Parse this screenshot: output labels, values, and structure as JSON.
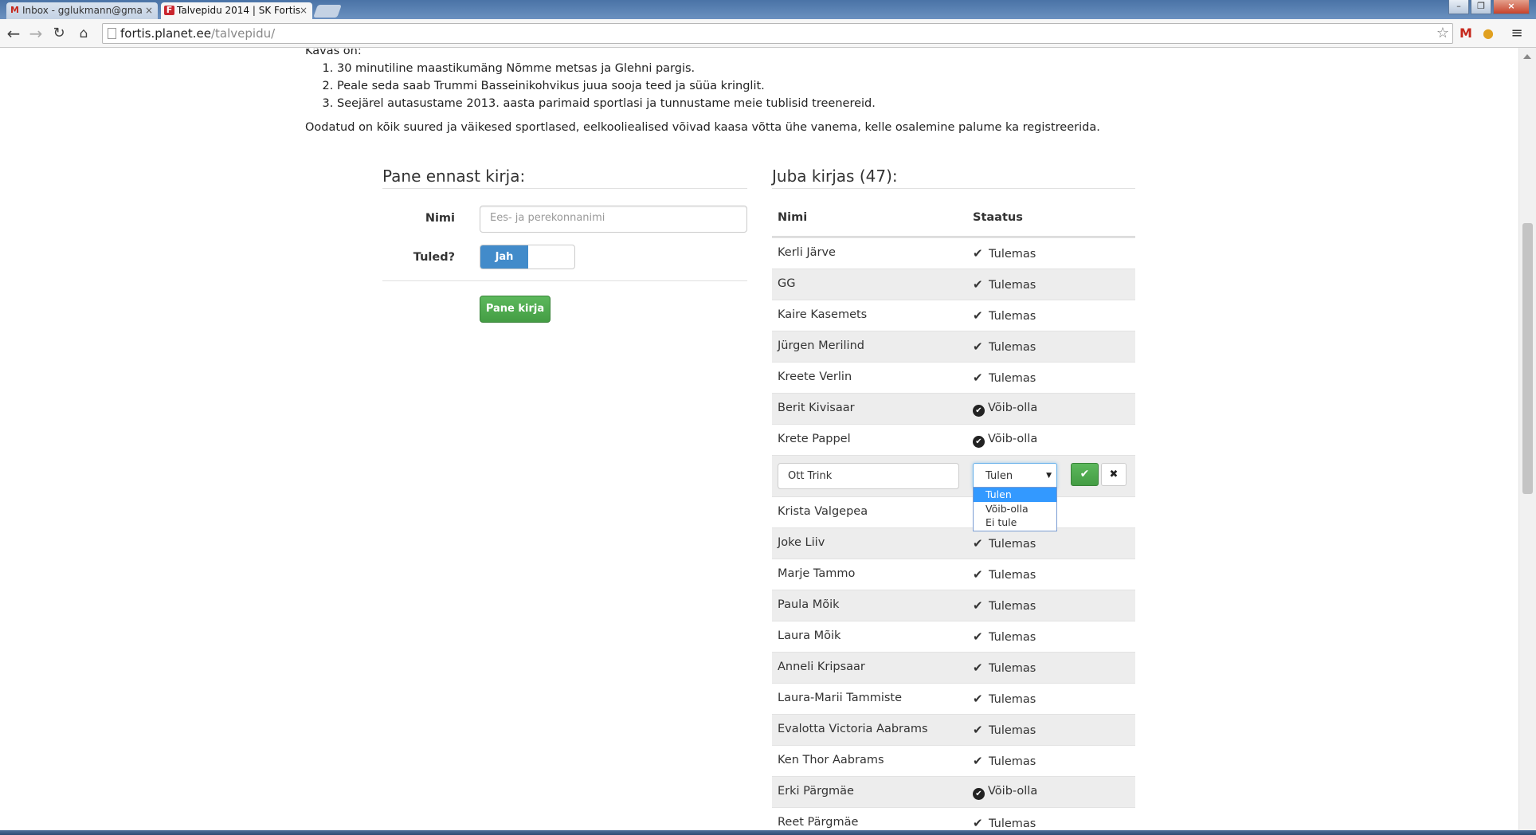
{
  "browser": {
    "tabs": [
      {
        "title": "Inbox - gglukmann@gma",
        "favicon": "gmail-icon"
      },
      {
        "title": "Talvepidu 2014 | SK Fortis",
        "favicon": "site-icon"
      }
    ],
    "url_host": "fortis.planet.ee",
    "url_path": "/talvepidu/"
  },
  "intro": {
    "heading": "Kavas on:",
    "items": [
      "30 minutiline maastikumäng Nõmme metsas ja Glehni pargis.",
      "Peale seda saab Trummi Basseinikohvikus juua sooja teed ja süüa kringlit.",
      "Seejärel autasustame 2013. aasta parimaid sportlasi ja tunnustame meie tublisid treenereid."
    ],
    "paragraph": "Oodatud on kõik suured ja väikesed sportlased, eelkooliealised võivad kaasa võtta ühe vanema, kelle osalemine palume ka registreerida."
  },
  "signup": {
    "heading": "Pane ennast kirja:",
    "name_label": "Nimi",
    "name_placeholder": "Ees- ja perekonnanimi",
    "coming_label": "Tuled?",
    "toggle_on_label": "Jah",
    "submit_label": "Pane kirja"
  },
  "registered": {
    "heading": "Juba kirjas (47):",
    "col_name": "Nimi",
    "col_status": "Staatus",
    "rows_before": [
      {
        "name": "Kerli Järve",
        "status": "Tulemas",
        "icon": "check"
      },
      {
        "name": "GG",
        "status": "Tulemas",
        "icon": "check"
      },
      {
        "name": "Kaire Kasemets",
        "status": "Tulemas",
        "icon": "check"
      },
      {
        "name": "Jürgen Merilind",
        "status": "Tulemas",
        "icon": "check"
      },
      {
        "name": "Kreete Verlin",
        "status": "Tulemas",
        "icon": "check"
      },
      {
        "name": "Berit Kivisaar",
        "status": "Võib-olla",
        "icon": "check-circle"
      },
      {
        "name": "Krete Pappel",
        "status": "Võib-olla",
        "icon": "check-circle"
      }
    ],
    "edit_row": {
      "name_value": "Ott Trink",
      "select_value": "Tulen",
      "options": [
        "Tulen",
        "Võib-olla",
        "Ei tule"
      ]
    },
    "rows_after": [
      {
        "name": "Krista Valgepea",
        "status": "",
        "icon": ""
      },
      {
        "name": "Joke Liiv",
        "status": "Tulemas",
        "icon": "check"
      },
      {
        "name": "Marje Tammo",
        "status": "Tulemas",
        "icon": "check"
      },
      {
        "name": "Paula Mõik",
        "status": "Tulemas",
        "icon": "check"
      },
      {
        "name": "Laura Mõik",
        "status": "Tulemas",
        "icon": "check"
      },
      {
        "name": "Anneli Kripsaar",
        "status": "Tulemas",
        "icon": "check"
      },
      {
        "name": "Laura-Marii Tammiste",
        "status": "Tulemas",
        "icon": "check"
      },
      {
        "name": "Evalotta Victoria Aabrams",
        "status": "Tulemas",
        "icon": "check"
      },
      {
        "name": "Ken Thor Aabrams",
        "status": "Tulemas",
        "icon": "check"
      },
      {
        "name": "Erki Pärgmäe",
        "status": "Võib-olla",
        "icon": "check-circle"
      },
      {
        "name": "Reet Pärgmäe",
        "status": "Tulemas",
        "icon": "check"
      }
    ]
  },
  "colors": {
    "primary": "#428bca",
    "success": "#5cb85c",
    "select_highlight": "#3399ff"
  }
}
